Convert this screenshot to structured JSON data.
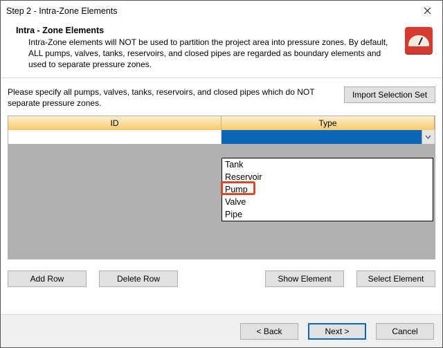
{
  "window": {
    "title": "Step 2 - Intra-Zone Elements"
  },
  "header": {
    "title": "Intra - Zone Elements",
    "description": "Intra-Zone elements will NOT be used to partition the project area into pressure zones.  By default, ALL pumps, valves, tanks, reservoirs, and closed pipes are regarded as boundary elements and used to separate pressure zones."
  },
  "instruction": "Please specify all pumps, valves, tanks, reservoirs, and closed pipes which do NOT separate pressure zones.",
  "buttons": {
    "import_selection_set": "Import Selection Set",
    "add_row": "Add Row",
    "delete_row": "Delete Row",
    "show_element": "Show Element",
    "select_element": "Select Element",
    "back": "< Back",
    "next": "Next >",
    "cancel": "Cancel"
  },
  "grid": {
    "columns": {
      "id": "ID",
      "type": "Type"
    },
    "dropdown_options": [
      "Tank",
      "Reservoir",
      "Pump",
      "Valve",
      "Pipe"
    ],
    "highlighted_option_index": 2
  },
  "colors": {
    "accent_orange": "#f6c96b",
    "selection_blue": "#0a66b7",
    "callout_red": "#d64a24",
    "brand_red": "#d63a2e"
  }
}
